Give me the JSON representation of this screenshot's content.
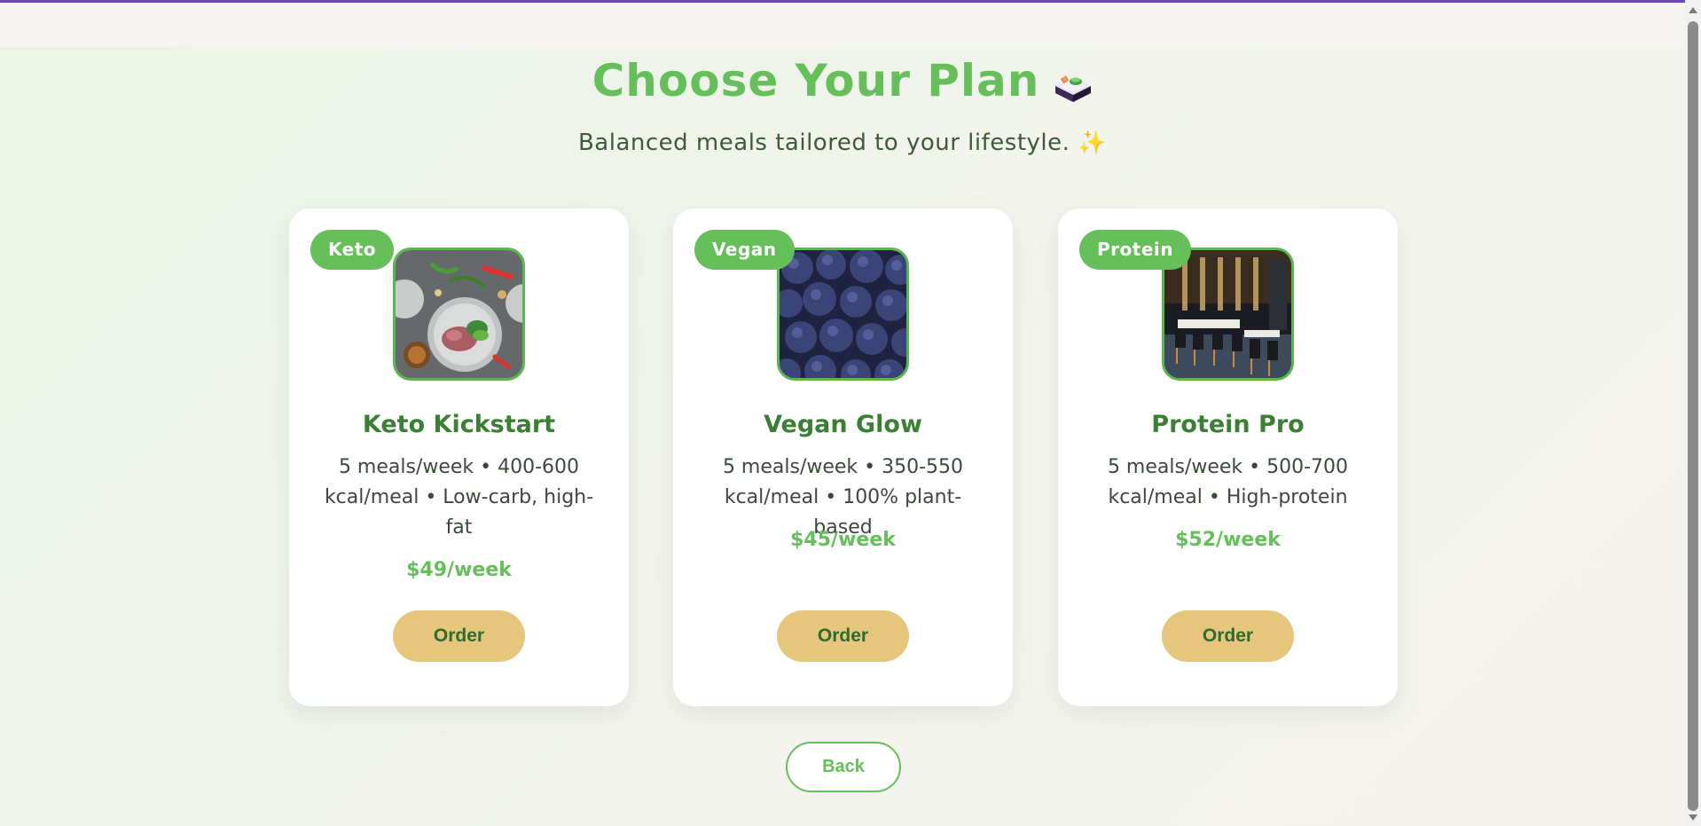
{
  "header": {
    "title": "Choose Your Plan",
    "title_icon": "bento-box-icon",
    "subtitle": "Balanced meals tailored to your lifestyle. ✨"
  },
  "plans": [
    {
      "badge": "Keto",
      "name": "Keto Kickstart",
      "description": "5 meals/week • 400-600 kcal/meal • Low-carb, high-fat",
      "price": "$49/week",
      "order_label": "Order",
      "image": "keto-meal-photo"
    },
    {
      "badge": "Vegan",
      "name": "Vegan Glow",
      "description": "5 meals/week • 350-550 kcal/meal • 100% plant-based",
      "price": "$45/week",
      "order_label": "Order",
      "image": "blueberries-photo"
    },
    {
      "badge": "Protein",
      "name": "Protein Pro",
      "description": "5 meals/week • 500-700 kcal/meal • High-protein",
      "price": "$52/week",
      "order_label": "Order",
      "image": "restaurant-interior-photo"
    }
  ],
  "back_label": "Back",
  "colors": {
    "accent_green": "#66bf5b",
    "dark_green": "#3b7f34",
    "button_gold": "#e6c67c",
    "top_accent": "#6f46b8"
  }
}
